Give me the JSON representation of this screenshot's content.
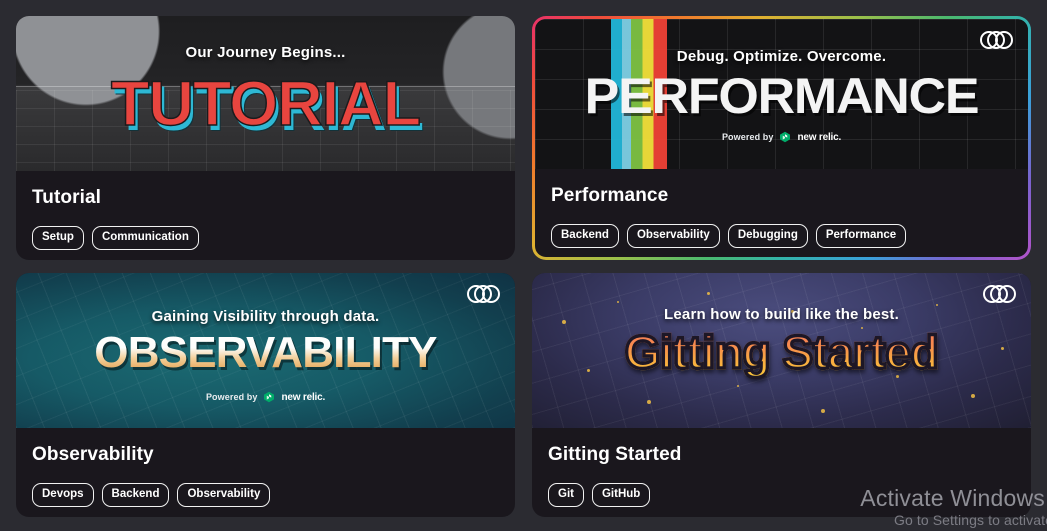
{
  "page": {
    "background_color": "#2b2b31",
    "card_background_color": "#1a171d"
  },
  "cards": [
    {
      "id": "tutorial",
      "title": "Tutorial",
      "banner": {
        "tagline": "Our Journey Begins...",
        "headline": "TUTORIAL",
        "powered_by": "",
        "brand": "",
        "has_cco_logo": false,
        "headline_color": "#e8453f",
        "accent_color": "#2eb8d4",
        "background_color": "#242426"
      },
      "tags": [
        "Setup",
        "Communication"
      ],
      "highlighted": false
    },
    {
      "id": "performance",
      "title": "Performance",
      "banner": {
        "tagline": "Debug. Optimize. Overcome.",
        "headline": "PERFORMANCE",
        "powered_by": "Powered by",
        "brand": "new relic.",
        "has_cco_logo": true,
        "headline_color": "#f4f4f4",
        "accent_color": "#ef4136",
        "background_color": "#131315"
      },
      "tags": [
        "Backend",
        "Observability",
        "Debugging",
        "Performance"
      ],
      "highlighted": true
    },
    {
      "id": "observability",
      "title": "Observability",
      "banner": {
        "tagline": "Gaining Visibility through data.",
        "headline": "OBSERVABILITY",
        "powered_by": "Powered by",
        "brand": "new relic.",
        "has_cco_logo": true,
        "headline_color": "#e6a95d",
        "accent_color": "#1b6a72",
        "background_color": "#13505e"
      },
      "tags": [
        "Devops",
        "Backend",
        "Observability"
      ],
      "highlighted": false
    },
    {
      "id": "gitting-started",
      "title": "Gitting Started",
      "banner": {
        "tagline": "Learn how to build like the best.",
        "headline": "Gitting Started",
        "powered_by": "",
        "brand": "",
        "has_cco_logo": true,
        "headline_color": "#f9ad40",
        "accent_color": "#f2c044",
        "background_color": "#3b3c67"
      },
      "tags": [
        "Git",
        "GitHub"
      ],
      "highlighted": false
    }
  ],
  "watermark": {
    "line1": "Activate Windows",
    "line2": "Go to Settings to activate"
  }
}
